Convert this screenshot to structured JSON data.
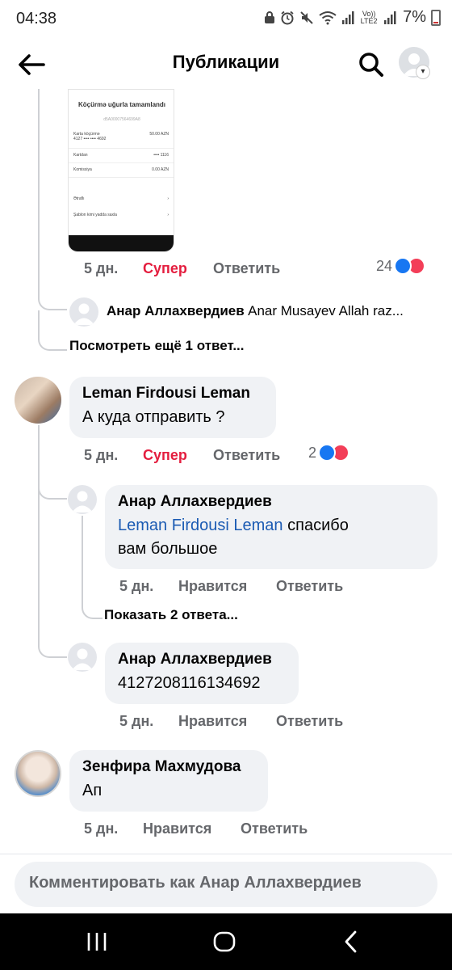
{
  "status_bar": {
    "time": "04:38",
    "network_label": "Vo)) LTE2",
    "battery": "7%",
    "icons": [
      "lock-icon",
      "alarm-icon",
      "mute-icon",
      "wifi-icon",
      "signal-icon",
      "battery-icon"
    ]
  },
  "header": {
    "title": "Публикации",
    "back_icon": "arrow-left-icon",
    "search_icon": "search-icon"
  },
  "attachment": {
    "title": "Köçürmə uğurla tamamlandı",
    "id": "d5A00007564699A8",
    "card_label": "Karta köçürmə",
    "card_number": "4127 •••• •••• 4692",
    "amount": "50.00 AZN",
    "row1_label": "Kartdan",
    "row1_value": "•••• 1116",
    "row2_label": "Komissiya",
    "row2_value": "0.00 AZN",
    "action1": "Ətraflı",
    "action2": "Şablon kimi yadda saxla"
  },
  "comments": [
    {
      "time": "5 дн.",
      "reaction_label": "Супер",
      "reply_label": "Ответить",
      "reaction_count": "24"
    },
    {
      "author": "Анар Аллахвердиев",
      "text": "Anar Musayev Allah raz..."
    },
    {
      "view_more": "Посмотреть ещё 1 ответ..."
    },
    {
      "author": "Leman Firdousi Leman",
      "text": "А куда отправить ?",
      "time": "5 дн.",
      "reaction_label": "Супер",
      "reply_label": "Ответить",
      "reaction_count": "2"
    },
    {
      "author": "Анар Аллахвердиев",
      "mention": "Leman Firdousi Leman",
      "text_line1": "спасибо",
      "text_line2": "вам большое",
      "time": "5 дн.",
      "like_label": "Нравится",
      "reply_label": "Ответить"
    },
    {
      "show_replies": "Показать 2 ответа..."
    },
    {
      "author": "Анар Аллахвердиев",
      "text": "4127208116134692",
      "time": "5 дн.",
      "like_label": "Нравится",
      "reply_label": "Ответить"
    },
    {
      "author": "Зенфира Махмудова",
      "text": "Ап",
      "time": "5 дн.",
      "like_label": "Нравится",
      "reply_label": "Ответить"
    }
  ],
  "composer": {
    "placeholder": "Комментировать как Анар Аллахвердиев"
  },
  "navbar": {
    "icons": [
      "recent-apps-icon",
      "home-icon",
      "back-icon"
    ]
  },
  "colors": {
    "accent_blue": "#1877f2",
    "reaction_red": "#e41e3f",
    "mention": "#1b5bb3",
    "bubble_bg": "#f0f2f5"
  }
}
